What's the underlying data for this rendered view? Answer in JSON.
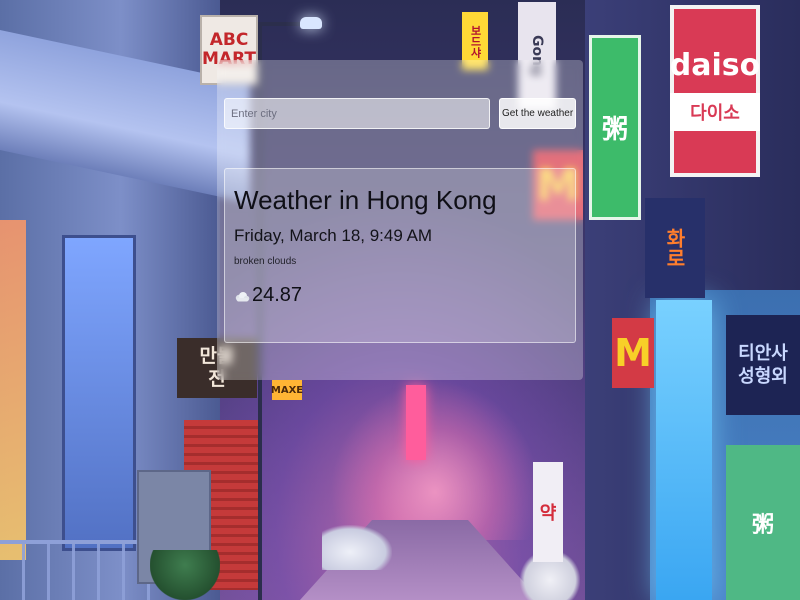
{
  "search": {
    "placeholder": "Enter city",
    "value": "",
    "button_label": "Get the weather"
  },
  "weather": {
    "title": "Weather in Hong Kong",
    "date": "Friday, March 18, 9:49 AM",
    "description": "broken clouds",
    "icon": "cloud-icon",
    "temperature": "24.87"
  },
  "background_signs": {
    "abc": "ABC MART",
    "daiso": "daiso",
    "daiso_korean": "다이소",
    "pharmacy": "약",
    "maxe": "MAXE"
  },
  "colors": {
    "panel_overlay": "#ffffff",
    "daiso_red": "#d93a55",
    "text_dark": "#0f0f16"
  }
}
